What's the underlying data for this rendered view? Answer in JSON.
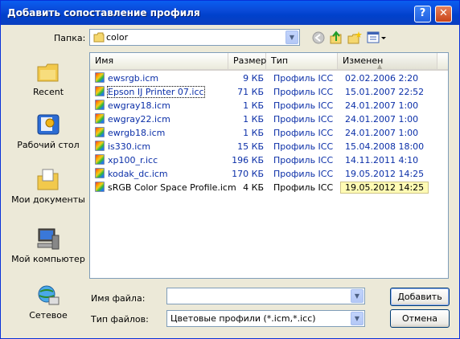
{
  "dialog": {
    "title": "Добавить сопоставление профиля",
    "help_label": "?",
    "close_label": "✕"
  },
  "folder": {
    "label": "Папка:",
    "value": "color"
  },
  "places": [
    {
      "label": "Recent"
    },
    {
      "label": "Рабочий стол"
    },
    {
      "label": "Мои документы"
    },
    {
      "label": "Мой компьютер"
    },
    {
      "label": "Сетевое"
    }
  ],
  "columns": {
    "name": "Имя",
    "size": "Размер",
    "type": "Тип",
    "modified": "Изменен"
  },
  "files": [
    {
      "name": "ewsrgb.icm",
      "size": "9 КБ",
      "type": "Профиль ICC",
      "modified": "02.02.2006 2:20"
    },
    {
      "name": "Epson IJ Printer 07.icc",
      "size": "71 КБ",
      "type": "Профиль ICC",
      "modified": "15.01.2007 22:52"
    },
    {
      "name": "ewgray18.icm",
      "size": "1 КБ",
      "type": "Профиль ICC",
      "modified": "24.01.2007 1:00"
    },
    {
      "name": "ewgray22.icm",
      "size": "1 КБ",
      "type": "Профиль ICC",
      "modified": "24.01.2007 1:00"
    },
    {
      "name": "ewrgb18.icm",
      "size": "1 КБ",
      "type": "Профиль ICC",
      "modified": "24.01.2007 1:00"
    },
    {
      "name": "is330.icm",
      "size": "15 КБ",
      "type": "Профиль ICC",
      "modified": "15.04.2008 18:00"
    },
    {
      "name": "xp100_r.icc",
      "size": "196 КБ",
      "type": "Профиль ICC",
      "modified": "14.11.2011 4:10"
    },
    {
      "name": "kodak_dc.icm",
      "size": "170 КБ",
      "type": "Профиль ICC",
      "modified": "19.05.2012 14:25"
    },
    {
      "name": "sRGB Color Space Profile.icm",
      "size": "4 КБ",
      "type": "Профиль ICC",
      "modified": "19.05.2012 14:25"
    }
  ],
  "filename": {
    "label": "Имя файла:",
    "value": ""
  },
  "filetype": {
    "label": "Тип файлов:",
    "value": "Цветовые профили (*.icm,*.icc)"
  },
  "buttons": {
    "add": "Добавить",
    "cancel": "Отмена"
  },
  "colors": {
    "titlebar": "#0a4ad8",
    "link_blue": "#0b2fa8",
    "tooltip_bg": "#fffbb4"
  }
}
